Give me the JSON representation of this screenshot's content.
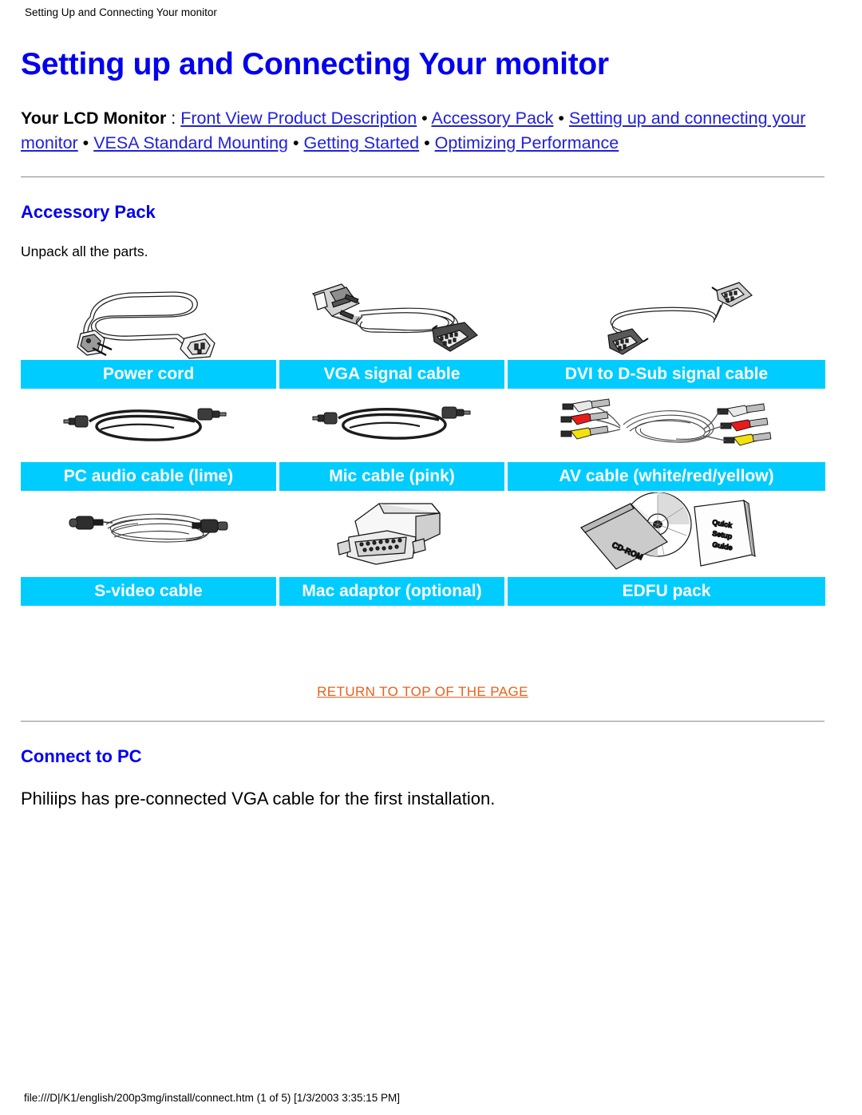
{
  "page": {
    "running_header": "Setting Up and Connecting Your monitor",
    "footer": "file:///D|/K1/english/200p3mg/install/connect.htm (1 of 5) [1/3/2003 3:35:15 PM]",
    "title": "Setting up and Connecting Your monitor"
  },
  "colors": {
    "heading_blue": "#0000ee",
    "link_blue": "#2020e0",
    "label_cyan": "#00ccff",
    "label_text": "#ffffff",
    "return_orange": "#e8601c",
    "rule_gray": "#9a9a9a"
  },
  "nav": {
    "lead": "Your LCD Monitor",
    "colon": " : ",
    "separator": " • ",
    "links": [
      {
        "label": "Front View Product Description"
      },
      {
        "label": "Accessory Pack"
      },
      {
        "label": "Setting up and connecting your monitor"
      },
      {
        "label": "VESA Standard Mounting"
      },
      {
        "label": "Getting Started"
      },
      {
        "label": "Optimizing Performance"
      }
    ]
  },
  "accessory_section": {
    "title": "Accessory Pack",
    "intro": "Unpack all the parts.",
    "items": [
      {
        "label": "Power cord",
        "icon": "power-cord-image"
      },
      {
        "label": "VGA signal cable",
        "icon": "vga-cable-image"
      },
      {
        "label": "DVI to D-Sub signal cable",
        "icon": "dvi-dsub-cable-image"
      },
      {
        "label": "PC audio cable (lime)",
        "icon": "pc-audio-cable-image"
      },
      {
        "label": "Mic cable (pink)",
        "icon": "mic-cable-image"
      },
      {
        "label": "AV cable (white/red/yellow)",
        "icon": "av-cable-image"
      },
      {
        "label": "S-video cable",
        "icon": "s-video-cable-image"
      },
      {
        "label": "Mac adaptor (optional)",
        "icon": "mac-adaptor-image"
      },
      {
        "label": "EDFU pack",
        "icon": "edfu-pack-image"
      }
    ],
    "edfu_art_labels": {
      "cdrom": "CD-ROM",
      "guide_line1": "Quick",
      "guide_line2": "Setup",
      "guide_line3": "Guide"
    }
  },
  "return_to_top": {
    "label": "RETURN TO TOP OF THE PAGE"
  },
  "connect_section": {
    "title": "Connect to PC",
    "body": "Philiips has pre-connected VGA cable for the first installation."
  }
}
